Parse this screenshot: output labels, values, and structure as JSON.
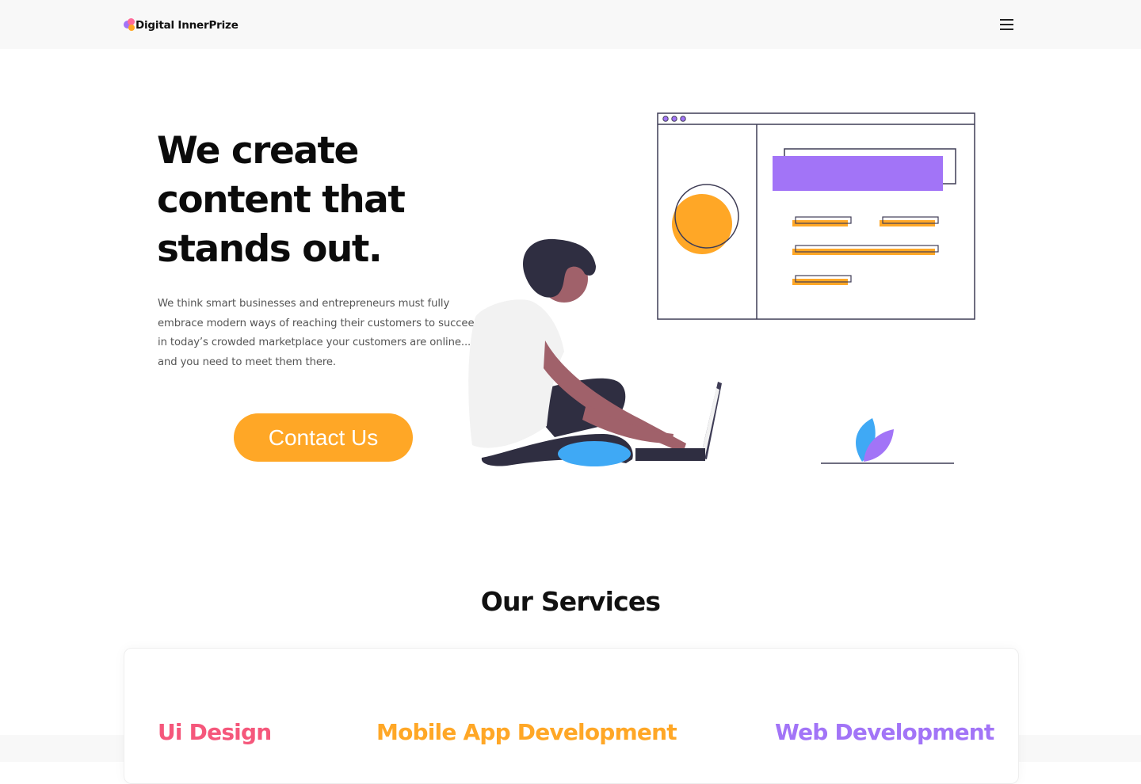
{
  "navbar": {
    "brand_name": "Digital InnerPrize",
    "menu_icon": "hamburger-icon"
  },
  "hero": {
    "title_lines": [
      "We create",
      "content that",
      "stands out."
    ],
    "description": "We think smart businesses and entrepreneurs must fully embrace modern ways of reaching their customers to succeed in today’s crowded marketplace your customers are online... and you need to meet them there.",
    "cta_label": "Contact Us"
  },
  "services": {
    "heading": "Our Services",
    "items": [
      {
        "title": "Ui Design",
        "color": "#f5577b"
      },
      {
        "title": "Mobile App Development",
        "color": "#ffa726"
      },
      {
        "title": "Web Development",
        "color": "#a274f7"
      }
    ]
  },
  "colors": {
    "accent_orange": "#ffa726",
    "accent_purple": "#a274f7",
    "accent_pink": "#f5577b",
    "accent_blue": "#3fa9f5",
    "dark_navy": "#2f2e41",
    "skin": "#a0616a"
  }
}
